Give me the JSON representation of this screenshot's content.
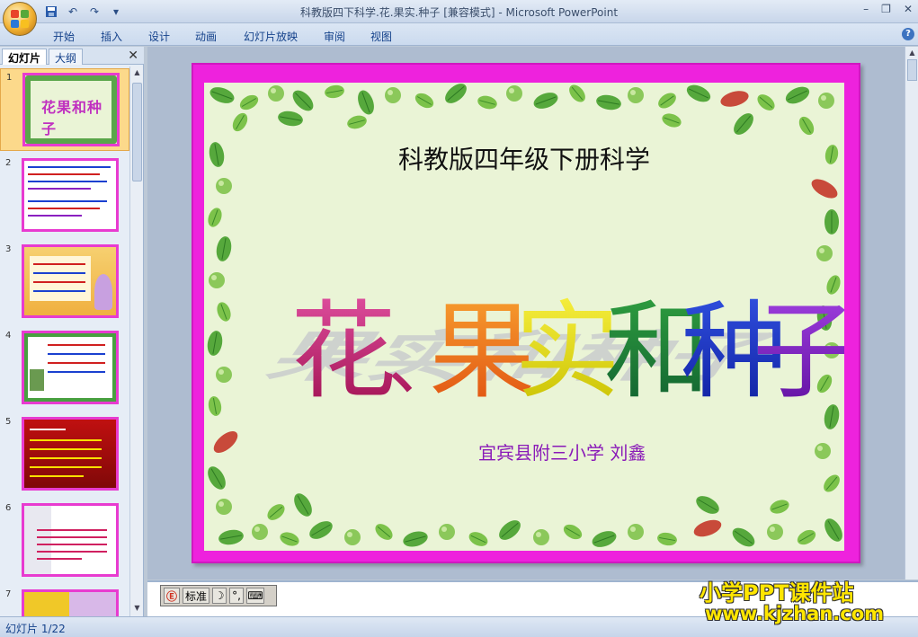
{
  "window": {
    "title": "科教版四下科学.花.果实.种子 [兼容模式] - Microsoft PowerPoint",
    "minimize": "–",
    "restore": "❐",
    "close": "✕"
  },
  "qat": {
    "save_icon": "save-icon",
    "undo_icon": "undo-icon",
    "redo_icon": "redo-icon"
  },
  "ribbon": {
    "tabs": [
      "开始",
      "插入",
      "设计",
      "动画",
      "幻灯片放映",
      "审阅",
      "视图"
    ],
    "help": "?"
  },
  "panel": {
    "tab_slides": "幻灯片",
    "tab_outline": "大纲",
    "close": "✕",
    "slide_numbers": [
      "1",
      "2",
      "3",
      "4",
      "5",
      "6",
      "7"
    ]
  },
  "slide": {
    "subtitle": "科教版四年级下册科学",
    "title": "花、果实和种子",
    "title_colors": [
      "#c0207a",
      "#f07818",
      "#e8e000",
      "#1a8a3a",
      "#2030c8",
      "#8a20c0"
    ],
    "author": "宜宾县附三小学  刘鑫",
    "border_color": "#ee22dd"
  },
  "ime": {
    "label": "标准"
  },
  "status": {
    "slide_counter": "幻灯片 1/22"
  },
  "watermark": {
    "line1": "小学PPT课件站",
    "line2": "www.kjzhan.com"
  }
}
